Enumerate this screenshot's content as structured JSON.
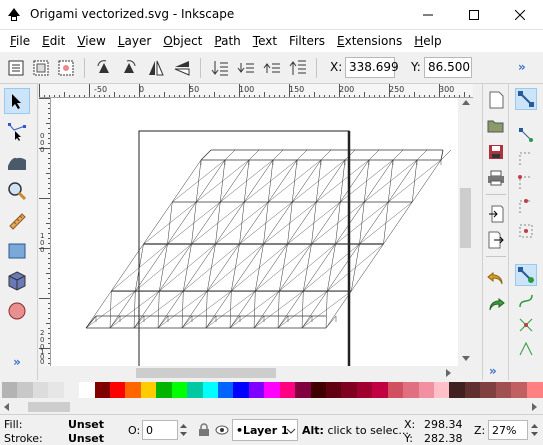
{
  "window": {
    "title": "Origami vectorized.svg - Inkscape",
    "controls": [
      "minimize-icon",
      "maximize-icon",
      "close-icon"
    ]
  },
  "menu": [
    {
      "underline": "F",
      "rest": "ile"
    },
    {
      "underline": "E",
      "rest": "dit"
    },
    {
      "underline": "V",
      "rest": "iew"
    },
    {
      "underline": "L",
      "rest": "ayer"
    },
    {
      "underline": "O",
      "rest": "bject"
    },
    {
      "underline": "P",
      "rest": "ath"
    },
    {
      "underline": "T",
      "rest": "ext"
    },
    {
      "underline": "",
      "rest": "Filters"
    },
    {
      "underline": "E",
      "rest": "xtensions"
    },
    {
      "underline": "H",
      "rest": "elp"
    }
  ],
  "toolbar": {
    "x_label": "X:",
    "x_value": "338.699",
    "y_label": "Y:",
    "y_value": "86.500",
    "overflow": "»"
  },
  "rulers": {
    "top_ticks": [
      "-50",
      "0",
      "50",
      "100",
      "150",
      "200",
      "250",
      "300"
    ],
    "left_ticks": [
      "0",
      "0",
      "0",
      "1",
      "0",
      "0",
      "2",
      "0",
      "0",
      "1",
      "0",
      "0",
      "5"
    ]
  },
  "toolbox": {
    "expand_label": "»"
  },
  "palette": {
    "colors": [
      "#b3b3b3",
      "#c8c8c8",
      "#dcdcdc",
      "#e6e6e6",
      "#f0f0f0",
      "#ffffff",
      "#800000",
      "#ff0000",
      "#ff6600",
      "#ffcc00",
      "#00b400",
      "#00ff00",
      "#00c8a0",
      "#00ffff",
      "#0064ff",
      "#0000ff",
      "#8000ff",
      "#ff00ff",
      "#ff0080",
      "#800040",
      "#400000",
      "#600010",
      "#800020",
      "#a00030",
      "#c00040",
      "#d05060",
      "#e07080",
      "#f090a0",
      "#ffc0c8",
      "#402020",
      "#603030",
      "#804040",
      "#a05050",
      "#c06060",
      "#ff8080"
    ]
  },
  "status": {
    "fill_label": "Fill:",
    "fill_value": "Unset",
    "stroke_label": "Stroke:",
    "stroke_value": "Unset",
    "opacity_label": "O:",
    "opacity_value": "0",
    "layer_value": "•Layer 1",
    "message_bold": "Alt:",
    "message": " click to selec...",
    "x_label": "X:",
    "x_value": "298.34",
    "y_label": "Y:",
    "y_value": "282.38",
    "zoom_label": "Z:",
    "zoom_value": "27%"
  }
}
